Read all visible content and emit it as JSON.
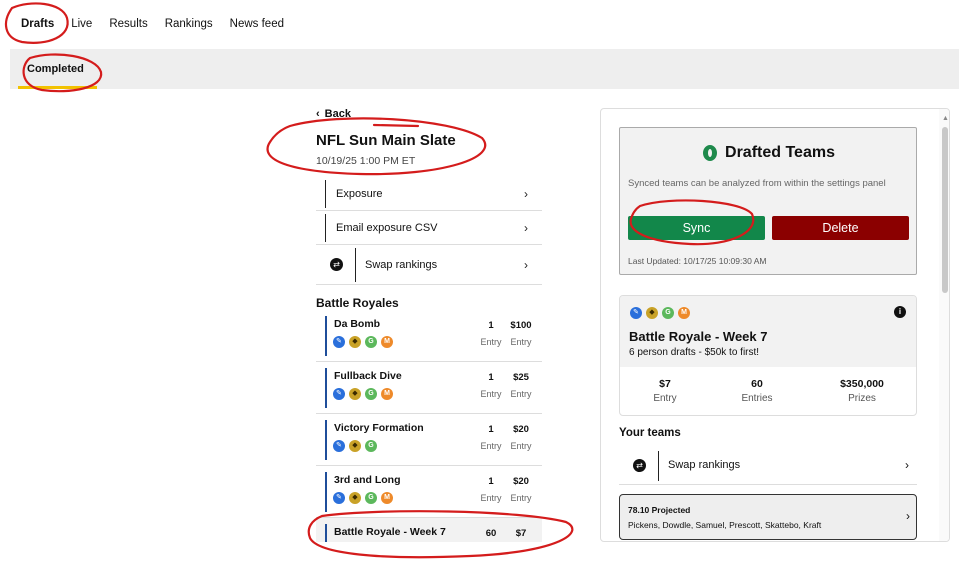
{
  "topnav": {
    "tabs": [
      "Drafts",
      "Live",
      "Results",
      "Rankings",
      "News feed"
    ],
    "active": "Drafts"
  },
  "subnav": {
    "tab": "Completed"
  },
  "slate": {
    "back": "Back",
    "title": "NFL Sun Main Slate",
    "datetime": "10/19/25 1:00 PM ET",
    "menu": {
      "exposure": "Exposure",
      "email_csv": "Email exposure CSV",
      "swap": "Swap rankings"
    },
    "section": "Battle Royales",
    "entries": [
      {
        "name": "Da Bomb",
        "entries": "1",
        "entries_label": "Entry",
        "fee": "$100",
        "fee_label": "Entry",
        "icons": [
          "U",
          "S",
          "G",
          "M"
        ]
      },
      {
        "name": "Fullback Dive",
        "entries": "1",
        "entries_label": "Entry",
        "fee": "$25",
        "fee_label": "Entry",
        "icons": [
          "U",
          "S",
          "G",
          "M"
        ]
      },
      {
        "name": "Victory Formation",
        "entries": "1",
        "entries_label": "Entry",
        "fee": "$20",
        "fee_label": "Entry",
        "icons": [
          "U",
          "S",
          "G"
        ]
      },
      {
        "name": "3rd and Long",
        "entries": "1",
        "entries_label": "Entry",
        "fee": "$20",
        "fee_label": "Entry",
        "icons": [
          "U",
          "S",
          "G",
          "M"
        ]
      },
      {
        "name": "Battle Royale - Week 7",
        "entries": "60",
        "fee": "$7"
      }
    ]
  },
  "drafted_teams": {
    "title": "Drafted Teams",
    "description": "Synced teams can be analyzed from within the settings panel",
    "sync": "Sync",
    "delete": "Delete",
    "last_updated": "Last Updated: 10/17/25 10:09:30 AM",
    "sync_color": "#12874a",
    "delete_color": "#8b0000"
  },
  "battle_royale": {
    "title": "Battle Royale - Week 7",
    "subtitle": "6 person drafts - $50k to first!",
    "info_icon": "i",
    "icons": [
      "U",
      "S",
      "G",
      "M"
    ],
    "stats": [
      {
        "value": "$7",
        "label": "Entry"
      },
      {
        "value": "60",
        "label": "Entries"
      },
      {
        "value": "$350,000",
        "label": "Prizes"
      }
    ]
  },
  "your_teams": {
    "heading": "Your teams",
    "swap": "Swap rankings",
    "team": {
      "projected": "78.10 Projected",
      "players": "Pickens, Dowdle, Samuel, Prescott, Skattebo, Kraft"
    }
  }
}
